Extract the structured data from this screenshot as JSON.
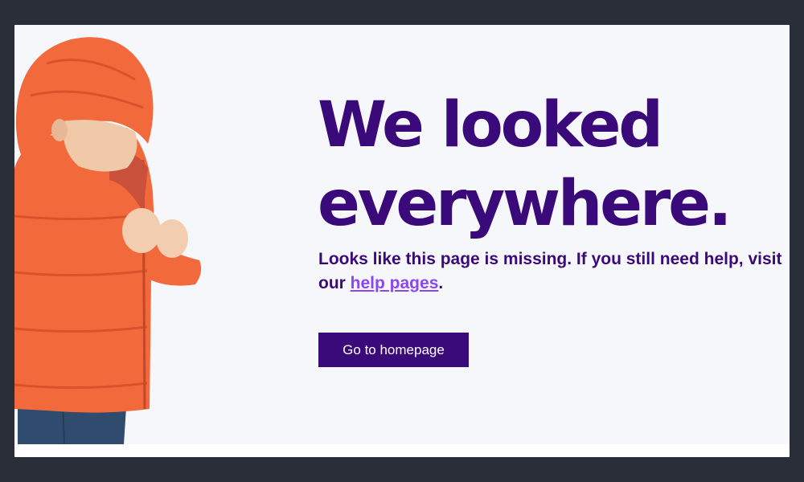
{
  "error_page": {
    "headline_line1": "We looked",
    "headline_line2": "everywhere.",
    "message_text": "Looks like this page is missing. If you still need help, visit our ",
    "help_link_label": "help pages",
    "message_end": ".",
    "home_button_label": "Go to homepage"
  },
  "colors": {
    "brand_purple": "#3b0a7a",
    "link_violet": "#8b46f2",
    "jacket_orange": "#f26a3c",
    "background": "#f6f7fb"
  },
  "icons": {
    "hero": "child-in-orange-puffer-jacket-illustration"
  }
}
